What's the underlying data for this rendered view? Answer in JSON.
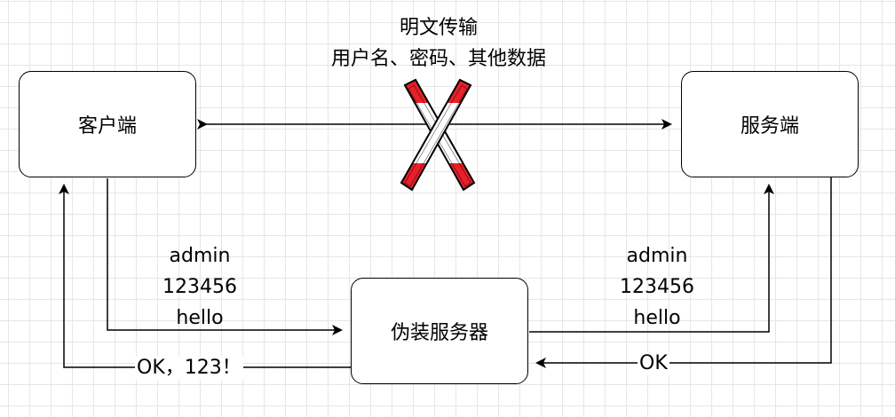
{
  "nodes": {
    "client": "客户端",
    "server": "服务端",
    "fake_server": "伪装服务器"
  },
  "top_caption": {
    "line1": "明文传输",
    "line2": "用户名、密码、其他数据"
  },
  "left_payload": [
    "admin",
    "123456",
    "hello"
  ],
  "right_payload": [
    "admin",
    "123456",
    "hello"
  ],
  "return_to_fake_label": "OK",
  "return_to_client_label": "OK，123！",
  "colors": {
    "line": "#000000",
    "cross_red": "#e8202a",
    "grid": "#e6e6e6"
  },
  "icons": {
    "blocked": "x-cross-icon"
  }
}
